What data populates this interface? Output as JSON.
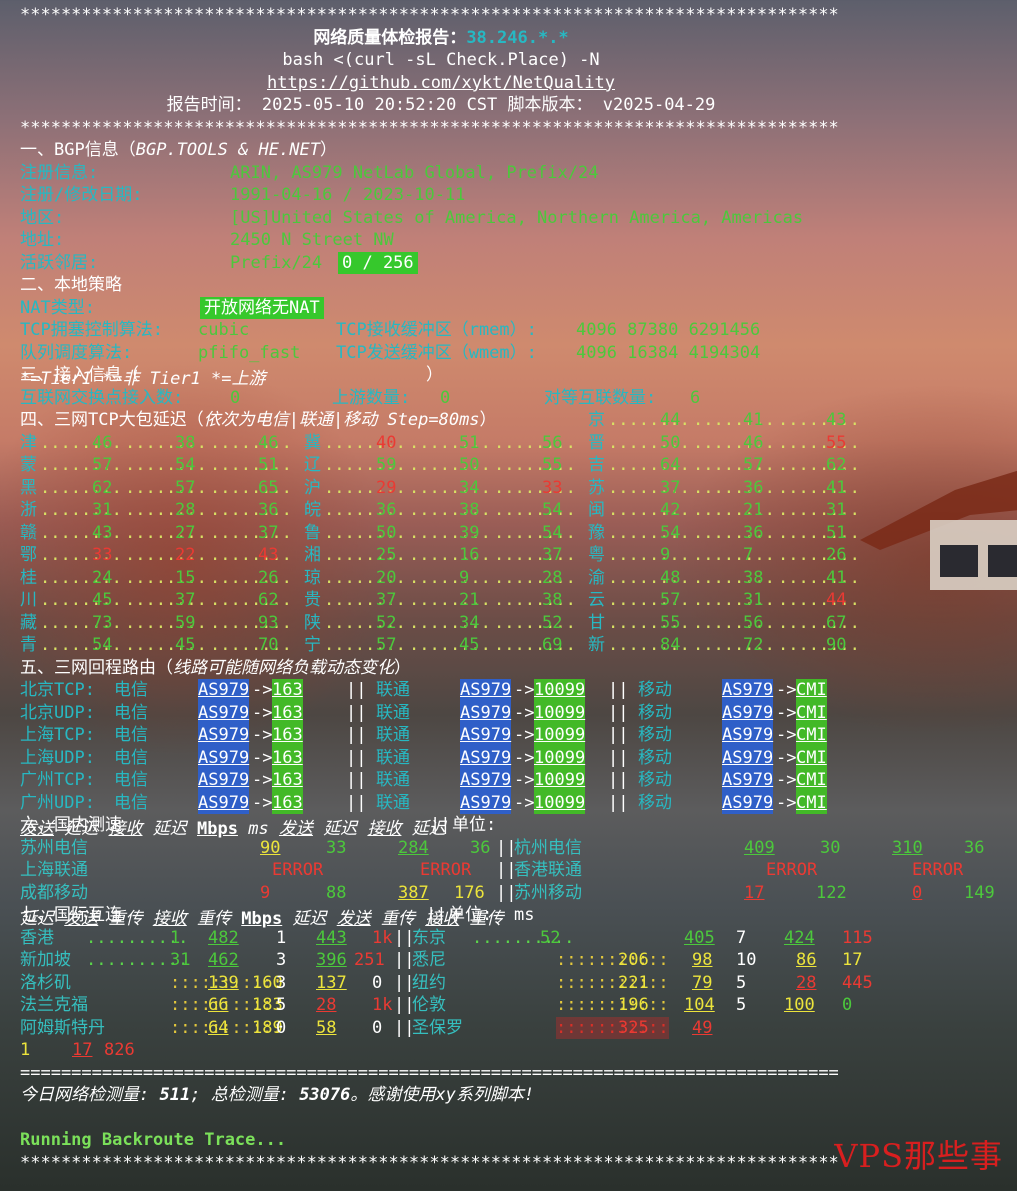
{
  "stars": "********************************************************************************",
  "header": {
    "title_label": "网络质量体检报告：",
    "title_ip": "38.246.*.*",
    "command": "bash <(curl -sL Check.Place) -N",
    "url": "https://github.com/xykt/NetQuality",
    "report_time_label": "报告时间：",
    "report_time": "2025-05-10 20:52:20 CST",
    "version_label": "脚本版本：",
    "version": "v2025-04-29"
  },
  "bgp": {
    "heading": "一、BGP信息（",
    "heading_src": "BGP.TOOLS & HE.NET",
    "heading_end": "）",
    "reg_label": "注册信息:",
    "reg_value": "ARIN, AS979 NetLab Global, Prefix/24",
    "date_label": "注册/修改日期:",
    "date_value": "1991-04-16 / 2023-10-11",
    "region_label": "地区:",
    "region_value": "[US]United States of America, Northern America, Americas",
    "addr_label": "地址:",
    "addr_value": "2450 N Street NW",
    "neighbor_label": "活跃邻居:",
    "neighbor_prefix": "Prefix/24",
    "neighbor_value": "0 / 256"
  },
  "local": {
    "heading": "二、本地策略",
    "nat_label": "NAT类型:",
    "nat_value": "开放网络无NAT",
    "tcp_cc_label": "TCP拥塞控制算法:",
    "tcp_cc_value": "cubic",
    "rmem_label": "TCP接收缓冲区（rmem）:",
    "rmem_value": "4096 87380 6291456",
    "qdisc_label": "队列调度算法:",
    "qdisc_value": "pfifo_fast",
    "wmem_label": "TCP发送缓冲区（wmem）:",
    "wmem_value": "4096 16384 4194304"
  },
  "access": {
    "heading": "三、接入信息（",
    "legend_t1": "*=Tier1",
    "legend_nt1": "*=非 Tier1",
    "legend_up": "*=上游",
    "heading_end": "）",
    "ix_label": "互联网交换点接入数:",
    "ix_value": "0",
    "upstream_label": "上游数量:",
    "upstream_value": "0",
    "peer_label": "对等互联数量:",
    "peer_value": "6"
  },
  "latency": {
    "heading": "四、三网TCP大包延迟（",
    "heading_note": "依次为电信|联通|移动 Step=80ms",
    "heading_end": "）",
    "rows": [
      [
        {
          "p": "京",
          "v": [
            "44",
            "41",
            "43"
          ],
          "c": [
            "g",
            "g",
            "g"
          ]
        }
      ],
      [
        {
          "p": "津",
          "v": [
            "46",
            "38",
            "46"
          ],
          "c": [
            "g",
            "g",
            "g"
          ]
        },
        {
          "p": "冀",
          "v": [
            "40",
            "51",
            "56"
          ],
          "c": [
            "r",
            "g",
            "g"
          ]
        },
        {
          "p": "晋",
          "v": [
            "50",
            "46",
            "55"
          ],
          "c": [
            "g",
            "g",
            "r"
          ]
        }
      ],
      [
        {
          "p": "蒙",
          "v": [
            "57",
            "54",
            "51"
          ],
          "c": [
            "g",
            "g",
            "g"
          ]
        },
        {
          "p": "辽",
          "v": [
            "59",
            "50",
            "55"
          ],
          "c": [
            "g",
            "g",
            "g"
          ]
        },
        {
          "p": "吉",
          "v": [
            "64",
            "57",
            "62"
          ],
          "c": [
            "g",
            "g",
            "g"
          ]
        }
      ],
      [
        {
          "p": "黑",
          "v": [
            "62",
            "57",
            "65"
          ],
          "c": [
            "g",
            "g",
            "g"
          ]
        },
        {
          "p": "沪",
          "v": [
            "29",
            "34",
            "33"
          ],
          "c": [
            "r",
            "g",
            "r"
          ]
        },
        {
          "p": "苏",
          "v": [
            "37",
            "36",
            "41"
          ],
          "c": [
            "g",
            "g",
            "g"
          ]
        }
      ],
      [
        {
          "p": "浙",
          "v": [
            "31",
            "28",
            "36"
          ],
          "c": [
            "g",
            "g",
            "g"
          ]
        },
        {
          "p": "皖",
          "v": [
            "36",
            "38",
            "54"
          ],
          "c": [
            "g",
            "g",
            "g"
          ]
        },
        {
          "p": "闽",
          "v": [
            "42",
            "21",
            "31"
          ],
          "c": [
            "g",
            "g",
            "g"
          ]
        }
      ],
      [
        {
          "p": "赣",
          "v": [
            "43",
            "27",
            "37"
          ],
          "c": [
            "g",
            "g",
            "g"
          ]
        },
        {
          "p": "鲁",
          "v": [
            "50",
            "39",
            "54"
          ],
          "c": [
            "g",
            "g",
            "g"
          ]
        },
        {
          "p": "豫",
          "v": [
            "54",
            "36",
            "51"
          ],
          "c": [
            "g",
            "g",
            "g"
          ]
        }
      ],
      [
        {
          "p": "鄂",
          "v": [
            "33",
            "22",
            "43"
          ],
          "c": [
            "r",
            "r",
            "r"
          ]
        },
        {
          "p": "湘",
          "v": [
            "25",
            "16",
            "37"
          ],
          "c": [
            "g",
            "g",
            "g"
          ]
        },
        {
          "p": "粤",
          "v": [
            "9",
            "7",
            "26"
          ],
          "c": [
            "g",
            "g",
            "g"
          ]
        }
      ],
      [
        {
          "p": "桂",
          "v": [
            "24",
            "15",
            "26"
          ],
          "c": [
            "g",
            "g",
            "g"
          ]
        },
        {
          "p": "琼",
          "v": [
            "20",
            "9",
            "28"
          ],
          "c": [
            "g",
            "g",
            "g"
          ]
        },
        {
          "p": "渝",
          "v": [
            "48",
            "38",
            "41"
          ],
          "c": [
            "g",
            "g",
            "g"
          ]
        }
      ],
      [
        {
          "p": "川",
          "v": [
            "45",
            "37",
            "62"
          ],
          "c": [
            "g",
            "g",
            "g"
          ]
        },
        {
          "p": "贵",
          "v": [
            "37",
            "21",
            "38"
          ],
          "c": [
            "g",
            "g",
            "g"
          ]
        },
        {
          "p": "云",
          "v": [
            "57",
            "31",
            "44"
          ],
          "c": [
            "g",
            "g",
            "r"
          ]
        }
      ],
      [
        {
          "p": "藏",
          "v": [
            "73",
            "59",
            "93"
          ],
          "c": [
            "g",
            "g",
            "g"
          ]
        },
        {
          "p": "陕",
          "v": [
            "52",
            "34",
            "52"
          ],
          "c": [
            "g",
            "g",
            "g"
          ]
        },
        {
          "p": "甘",
          "v": [
            "55",
            "56",
            "67"
          ],
          "c": [
            "g",
            "g",
            "g"
          ]
        }
      ],
      [
        {
          "p": "青",
          "v": [
            "54",
            "45",
            "70"
          ],
          "c": [
            "g",
            "g",
            "g"
          ]
        },
        {
          "p": "宁",
          "v": [
            "57",
            "45",
            "69"
          ],
          "c": [
            "g",
            "g",
            "g"
          ]
        },
        {
          "p": "新",
          "v": [
            "84",
            "72",
            "90"
          ],
          "c": [
            "g",
            "g",
            "g"
          ]
        }
      ]
    ]
  },
  "routes": {
    "heading": "五、三网回程路由（",
    "heading_note": "线路可能随网络负载动态变化",
    "heading_end": "）",
    "rows": [
      {
        "label": "北京TCP:",
        "ct": "电信",
        "cu": "联通",
        "cm": "移动",
        "asn": "AS979",
        "arrow": "->",
        "ct_as": "163",
        "cu_as": "10099",
        "cm_as": "CMI"
      },
      {
        "label": "北京UDP:",
        "ct": "电信",
        "cu": "联通",
        "cm": "移动",
        "asn": "AS979",
        "arrow": "->",
        "ct_as": "163",
        "cu_as": "10099",
        "cm_as": "CMI"
      },
      {
        "label": "上海TCP:",
        "ct": "电信",
        "cu": "联通",
        "cm": "移动",
        "asn": "AS979",
        "arrow": "->",
        "ct_as": "163",
        "cu_as": "10099",
        "cm_as": "CMI"
      },
      {
        "label": "上海UDP:",
        "ct": "电信",
        "cu": "联通",
        "cm": "移动",
        "asn": "AS979",
        "arrow": "->",
        "ct_as": "163",
        "cu_as": "10099",
        "cm_as": "CMI"
      },
      {
        "label": "广州TCP:",
        "ct": "电信",
        "cu": "联通",
        "cm": "移动",
        "asn": "AS979",
        "arrow": "->",
        "ct_as": "163",
        "cu_as": "10099",
        "cm_as": "CMI"
      },
      {
        "label": "广州UDP:",
        "ct": "电信",
        "cu": "联通",
        "cm": "移动",
        "asn": "AS979",
        "arrow": "->",
        "ct_as": "163",
        "cu_as": "10099",
        "cm_as": "CMI"
      }
    ]
  },
  "domestic": {
    "heading": "六、国内测速",
    "h_send": "发送",
    "h_lat": "延迟",
    "h_recv": "接收",
    "h_lat2": "延迟",
    "h_unit": "单位:",
    "h_mbps": "Mbps",
    "h_ms": "ms",
    "rows": [
      {
        "name": "苏州电信",
        "send": "90",
        "lat": "33",
        "recv": "284",
        "lat2": "36",
        "name2": "杭州电信",
        "send2": "409",
        "lat3": "30",
        "recv2": "310",
        "lat4": "36"
      },
      {
        "name": "上海联通",
        "send": "ERROR",
        "lat": "",
        "recv": "ERROR",
        "lat2": "",
        "name2": "香港联通",
        "send2": "ERROR",
        "lat3": "",
        "recv2": "ERROR",
        "lat4": ""
      },
      {
        "name": "成都移动",
        "send": "9",
        "lat": "88",
        "recv": "387",
        "lat2": "176",
        "name2": "苏州移动",
        "send2": "17",
        "lat3": "122",
        "recv2": "0",
        "lat4": "149"
      }
    ]
  },
  "intl": {
    "heading": "七、国际互连",
    "h_lat": "延迟",
    "h_send": "发送",
    "h_retx": "重传",
    "h_recv": "接收",
    "h_retx2": "重传",
    "h_unit": "单位:",
    "h_ms": "ms",
    "h_mbps": "Mbps",
    "rows": [
      {
        "name": "香港",
        "lat": "1",
        "send": "482",
        "retx": "1",
        "recv": "443",
        "retx2": "1k",
        "name2": "东京",
        "lat2": "52",
        "send2": "405",
        "retx3": "7",
        "recv2": "424",
        "retx4": "115"
      },
      {
        "name": "新加坡",
        "lat": "31",
        "send": "462",
        "retx": "3",
        "recv": "396",
        "retx2": "251",
        "name2": "悉尼",
        "lat2": "206",
        "send2": "98",
        "retx3": "10",
        "recv2": "86",
        "retx4": "17"
      },
      {
        "name": "洛杉矶",
        "lat": "160",
        "send": "139",
        "retx": "3",
        "recv": "137",
        "retx2": "0",
        "name2": "纽约",
        "lat2": "221",
        "send2": "79",
        "retx3": "5",
        "recv2": "28",
        "retx4": "445"
      },
      {
        "name": "法兰克福",
        "lat": "183",
        "send": "66",
        "retx": "5",
        "recv": "28",
        "retx2": "1k",
        "name2": "伦敦",
        "lat2": "196",
        "send2": "104",
        "retx3": "5",
        "recv2": "100",
        "retx4": "0"
      },
      {
        "name": "阿姆斯特丹",
        "lat": "189",
        "send": "64",
        "retx": "0",
        "recv": "58",
        "retx2": "0",
        "name2": "圣保罗",
        "lat2": "325",
        "send2": "49",
        "retx3": "1",
        "recv2": "17",
        "retx4": "826"
      }
    ]
  },
  "footer": {
    "rule": "================================================================================",
    "stats_prefix": "今日网络检测量:",
    "stats_today": "511",
    "stats_mid": "; 总检测量:",
    "stats_total": "53076",
    "stats_suffix": "。感谢使用xy系列脚本!",
    "running": "Running Backroute Trace...",
    "watermark": "VPS那些事"
  }
}
